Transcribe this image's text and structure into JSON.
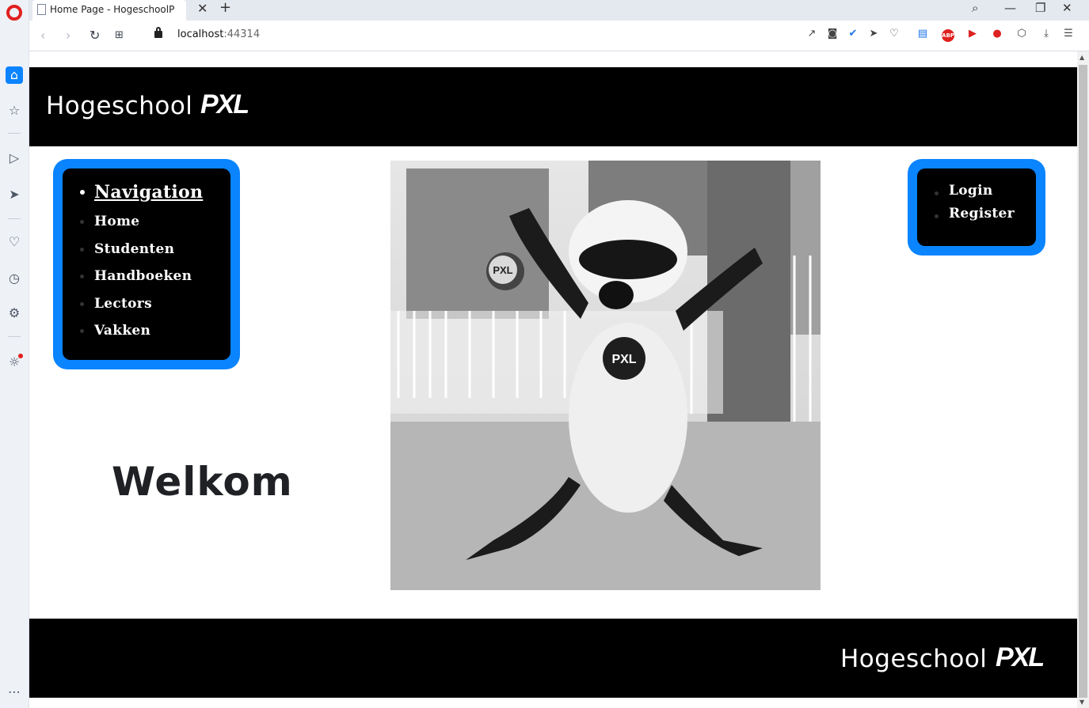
{
  "browser": {
    "tab_title": "Home Page - HogeschoolP",
    "url_host": "localhost",
    "url_port": ":44314",
    "extensions": [
      "share-icon",
      "camera-icon",
      "shield-check-icon",
      "send-icon",
      "heart-icon",
      "tabs-icon",
      "abp-icon",
      "player-icon",
      "record-icon",
      "cube-icon",
      "download-icon",
      "menu-icon"
    ],
    "abp_label": "ABP"
  },
  "header": {
    "brand": "Hogeschool",
    "logo": "PXL"
  },
  "nav": {
    "title": "Navigation",
    "items": [
      "Home",
      "Studenten",
      "Handboeken",
      "Lectors",
      "Vakken"
    ]
  },
  "auth": {
    "items": [
      "Login",
      "Register"
    ]
  },
  "main": {
    "welcome": "Welkom",
    "photo": "PXL mascot panda jumping"
  },
  "footer": {
    "brand": "Hogeschool",
    "logo": "PXL"
  },
  "colors": {
    "accent": "#0a84ff",
    "bar": "#000000",
    "opera_red": "#e0201e"
  }
}
